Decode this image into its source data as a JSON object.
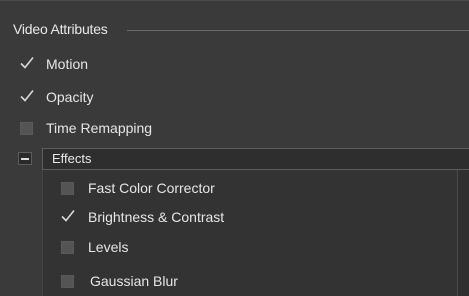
{
  "section": {
    "title": "Video Attributes"
  },
  "attributes": [
    {
      "label": "Motion",
      "checked": true
    },
    {
      "label": "Opacity",
      "checked": true
    },
    {
      "label": "Time Remapping",
      "checked": false
    }
  ],
  "effects": {
    "label": "Effects",
    "expanded": true,
    "items": [
      {
        "label": "Fast Color Corrector",
        "checked": false
      },
      {
        "label": "Brightness & Contrast",
        "checked": true
      },
      {
        "label": "Levels",
        "checked": false
      },
      {
        "label": "Gaussian Blur",
        "checked": false
      }
    ]
  },
  "icons": {
    "check": "checkmark-icon",
    "collapse": "minus-icon"
  }
}
